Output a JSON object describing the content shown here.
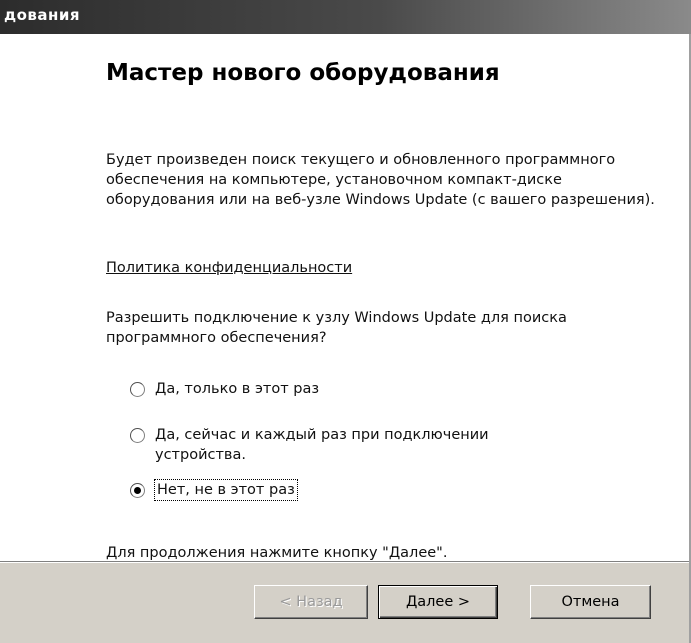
{
  "window": {
    "title": "дования"
  },
  "wizard": {
    "title": "Мастер нового оборудования",
    "description": "Будет произведен поиск текущего и обновленного программного обеспечения на компьютере, установочном компакт-диске оборудования или на веб-узле Windows Update (с вашего разрешения).",
    "privacy_link": "Политика конфиденциальности",
    "question": "Разрешить подключение к узлу Windows Update для поиска программного обеспечения?",
    "options": [
      {
        "label": "Да, только в этот раз",
        "checked": false
      },
      {
        "label": "Да, сейчас и каждый раз при подключении устройства.",
        "checked": false
      },
      {
        "label": "Нет, не в этот раз",
        "checked": true
      }
    ],
    "continue_hint": "Для продолжения нажмите кнопку \"Далее\"."
  },
  "buttons": {
    "back": "< Назад",
    "next": "Далее >",
    "cancel": "Отмена"
  },
  "colors": {
    "titlebar_start": "#2c2c2c",
    "dialog_face": "#d4d0c8",
    "content_bg": "#ffffff"
  }
}
